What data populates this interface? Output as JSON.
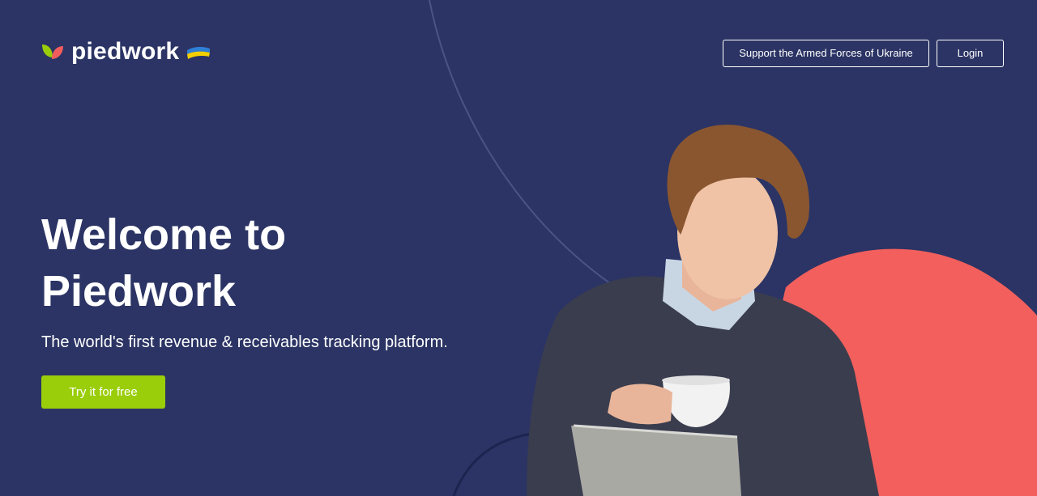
{
  "brand": {
    "name": "piedwork",
    "logo_icon": "leaf-logo-icon",
    "flag_icon": "ukraine-flag-icon",
    "colors": {
      "background": "#2b3464",
      "leaf_green": "#9acd0a",
      "leaf_red": "#f25c5c",
      "flag_blue": "#2f7fd6",
      "flag_yellow": "#f5d000",
      "coral_blob": "#f25f5c"
    }
  },
  "nav": {
    "support_label": "Support the Armed Forces of Ukraine",
    "login_label": "Login"
  },
  "hero": {
    "title_line1": "Welcome to",
    "title_line2": "Piedwork",
    "subtitle": "The world's first revenue & receivables tracking platform.",
    "cta_label": "Try it for free",
    "cta_color": "#9acd0a",
    "image": "man-with-coffee-and-tablet-photo"
  }
}
